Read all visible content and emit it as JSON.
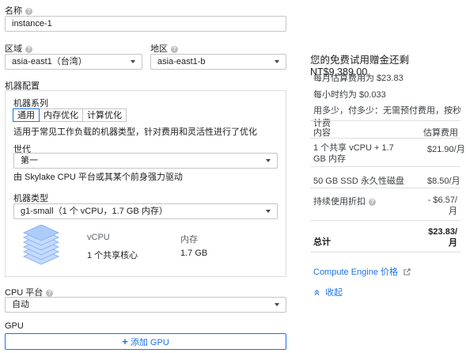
{
  "name": {
    "label": "名称",
    "value": "instance-1"
  },
  "region": {
    "label": "区域",
    "value": "asia-east1（台湾）"
  },
  "zone": {
    "label": "地区",
    "value": "asia-east1-b"
  },
  "machine_config": {
    "label": "机器配置",
    "series_label": "机器系列",
    "tabs": [
      "通用",
      "内存优化",
      "计算优化"
    ],
    "tab_description": "适用于常见工作负载的机器类型，针对费用和灵活性进行了优化",
    "generation_label": "世代",
    "generation_value": "第一",
    "generation_note": "由 Skylake CPU 平台或其某个前身强力驱动",
    "type_label": "机器类型",
    "type_value": "g1-small（1 个 vCPU，1.7 GB 内存）",
    "vcpu_header": "vCPU",
    "memory_header": "内存",
    "vcpu_value": "1 个共享核心",
    "memory_value": "1.7 GB"
  },
  "cpu_platform": {
    "label": "CPU 平台",
    "value": "自动"
  },
  "gpu": {
    "label": "GPU",
    "button": "添加 GPU"
  },
  "pricing": {
    "title": "您的免费试用赠金还剩 NT$9,389.00",
    "monthly_estimate": "每月估算费用为 $23.83",
    "hourly_estimate": "每小时约为 $0.033",
    "note": "用多少，付多少：无需预付费用，按秒计费",
    "col_item": "内容",
    "col_cost": "估算费用",
    "rows": [
      {
        "item": "1 个共享 vCPU + 1.7 GB 内存",
        "cost": "$21.90/月"
      },
      {
        "item": "50 GB SSD 永久性磁盘",
        "cost": "$8.50/月"
      },
      {
        "item": "持续使用折扣",
        "cost": "- $6.57/月"
      }
    ],
    "total_label": "总计",
    "total_value": "$23.83/月",
    "link": "Compute Engine 价格",
    "collapse": "收起"
  }
}
